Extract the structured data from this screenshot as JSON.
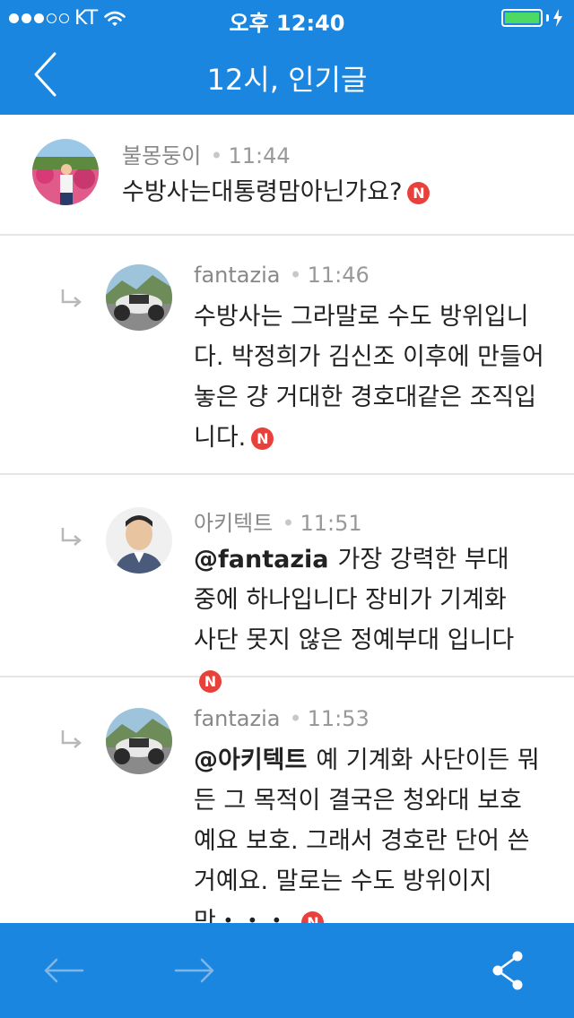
{
  "status_bar": {
    "carrier": "KT",
    "time": "오후 12:40",
    "battery_color": "#4cd964"
  },
  "nav": {
    "title": "12시, 인기글",
    "back_icon": "chevron-left-icon"
  },
  "comments": [
    {
      "author": "불몽둥이",
      "time": "11:44",
      "mention": "",
      "text": "수방사는대통령맘아닌가요?",
      "badge": "N"
    },
    {
      "author": "fantazia",
      "time": "11:46",
      "mention": "",
      "text": "수방사는 그라말로 수도 방위입니다. 박정희가 김신조 이후에 만들어 놓은 걍 거대한 경호대같은 조직입니다.",
      "badge": "N"
    },
    {
      "author": "아키텍트",
      "time": "11:51",
      "mention": "@fantazia",
      "text": "가장 강력한 부대중에 하나입니다 장비가 기계화 사단 못지 않은 정예부대 입니다",
      "badge": "N"
    },
    {
      "author": "fantazia",
      "time": "11:53",
      "mention": "@아키텍트",
      "text": "예 기계화 사단이든 뭐든 그 목적이 결국은 청와대 보호예요 보호. 그래서 경호란 단어 쓴거예요. 말로는 수도 방위이지만・・・.",
      "badge": "N"
    }
  ],
  "toolbar": {
    "prev_icon": "arrow-left-icon",
    "next_icon": "arrow-right-icon",
    "share_icon": "share-icon"
  },
  "colors": {
    "accent": "#1a86e0",
    "badge": "#e8403a"
  }
}
